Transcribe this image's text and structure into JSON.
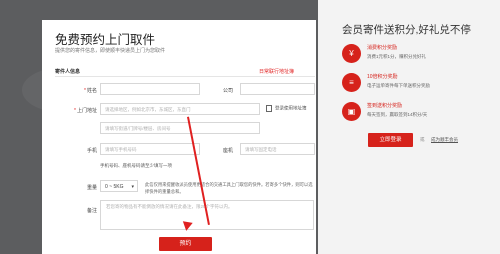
{
  "form": {
    "title": "免费预约上门取件",
    "subtitle": "提供您的寄件信息，即使顺丰快递员上门为您取件",
    "section_sender": "寄件人信息",
    "address_book_link": "日常联行地址簿",
    "name_label": "姓名",
    "name_placeholder": "",
    "company_label": "公司",
    "company_placeholder": "",
    "address_label": "上门地址",
    "region_placeholder": "请选择地区，例如北京市，东城区，东直门",
    "use_map_label": "登录使用地址簿",
    "detail_placeholder": "请填写街道/门牌号/楼层、房间号",
    "phone_label": "手机",
    "phone_placeholder": "请填写手机号码",
    "tel_label": "座机",
    "tel_placeholder": "请填写固定电话",
    "phone_tip": "手机号码、座机号码请至少填写一项",
    "weight_label": "重量",
    "weight_value": "0 ~ 5KG",
    "weight_note": "此信仅用来提醒收派员使用更适合的交通工具上门取您的快件。若寄多个快件，则可以选择快件的重量总和。",
    "note_label": "备注",
    "note_placeholder": "若您寄的物品有不能倒放的情况请在此备注，限20个字符以内。",
    "submit_label": "预约"
  },
  "benefits": {
    "title": "会员寄件送积分,好礼兑不停",
    "items": [
      {
        "icon": "coin-icon",
        "glyph": "¥",
        "head": "消费积分奖励",
        "desc": "消费1元积1分，赚积分兑好礼"
      },
      {
        "icon": "list-icon",
        "glyph": "≡",
        "head": "10倍积分奖励",
        "desc": "电子运单寄件每下单送积分奖励"
      },
      {
        "icon": "gift-icon",
        "glyph": "▣",
        "head": "签到送积分奖励",
        "desc": "每天签到，赢取签到14积分/天"
      }
    ],
    "login_label": "立即登录",
    "or_label": "或",
    "member_link": "成为顺丰会员"
  },
  "colors": {
    "accent": "#d6221b"
  }
}
